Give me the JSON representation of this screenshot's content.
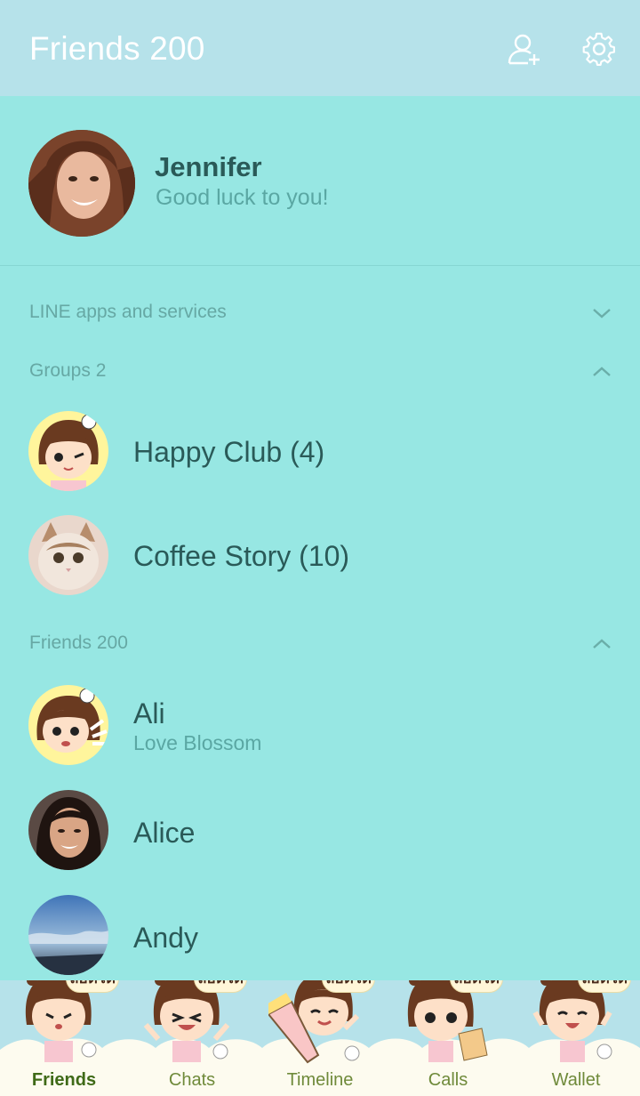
{
  "header": {
    "title": "Friends 200",
    "add_friend_icon": "add-friend-icon",
    "settings_icon": "gear-icon"
  },
  "profile": {
    "name": "Jennifer",
    "status": "Good luck to you!"
  },
  "sections": {
    "services": {
      "label": "LINE apps and services",
      "state": "collapsed"
    },
    "groups": {
      "label": "Groups 2",
      "state": "expanded"
    },
    "friends": {
      "label": "Friends 200",
      "state": "expanded"
    }
  },
  "groups": [
    {
      "name": "Happy Club (4)"
    },
    {
      "name": "Coffee Story (10)"
    }
  ],
  "friends": [
    {
      "name": "Ali",
      "status": "Love Blossom"
    },
    {
      "name": "Alice",
      "status": ""
    },
    {
      "name": "Andy",
      "status": ""
    }
  ],
  "tabs": [
    {
      "label": "Friends",
      "bubble": "ลอตโต้",
      "active": true
    },
    {
      "label": "Chats",
      "bubble": "ลอตโต้",
      "active": false
    },
    {
      "label": "Timeline",
      "bubble": "ลอตโต้",
      "active": false
    },
    {
      "label": "Calls",
      "bubble": "ลอตโต้",
      "active": false
    },
    {
      "label": "Wallet",
      "bubble": "ลอตโต้",
      "active": false
    }
  ],
  "colors": {
    "background": "#97e7e3",
    "header": "#b6e2ea",
    "text_dark": "#2a5a58",
    "text_muted": "#5aa7a3",
    "tab_active": "#3f6a17"
  }
}
